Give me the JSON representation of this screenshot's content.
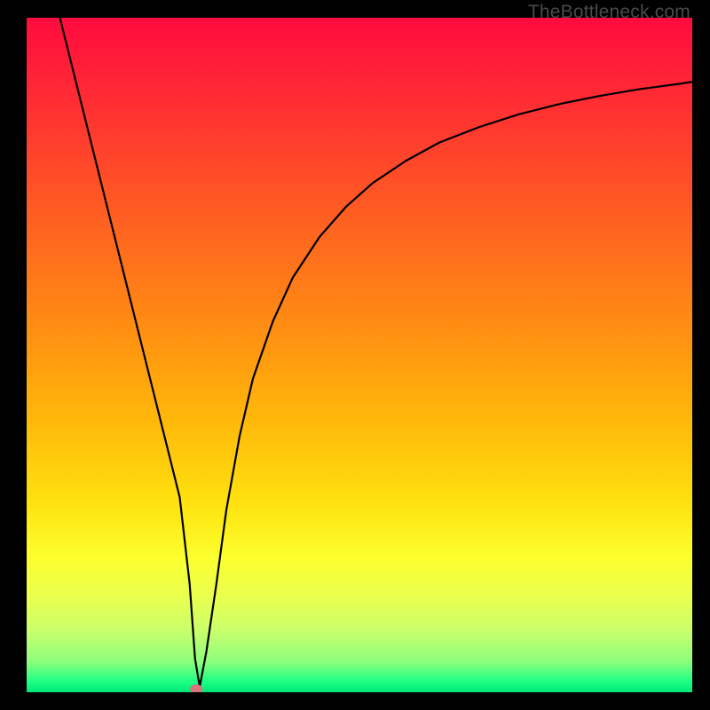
{
  "watermark": "TheBottleneck.com",
  "chart_data": {
    "type": "line",
    "title": "",
    "xlabel": "",
    "ylabel": "",
    "xlim": [
      0,
      100
    ],
    "ylim": [
      0,
      100
    ],
    "gradient_stops": [
      {
        "offset": 0.0,
        "color": "#ff0b3e"
      },
      {
        "offset": 0.12,
        "color": "#ff2c33"
      },
      {
        "offset": 0.28,
        "color": "#ff5a23"
      },
      {
        "offset": 0.45,
        "color": "#ff8b13"
      },
      {
        "offset": 0.6,
        "color": "#ffb90a"
      },
      {
        "offset": 0.72,
        "color": "#ffe20f"
      },
      {
        "offset": 0.8,
        "color": "#fcff2d"
      },
      {
        "offset": 0.86,
        "color": "#e9ff4f"
      },
      {
        "offset": 0.91,
        "color": "#c8ff6b"
      },
      {
        "offset": 0.955,
        "color": "#8dff7d"
      },
      {
        "offset": 0.985,
        "color": "#1bff84"
      },
      {
        "offset": 1.0,
        "color": "#00e57a"
      }
    ],
    "curve": {
      "x": [
        5,
        7,
        9,
        11,
        13,
        15,
        17,
        19,
        21,
        23,
        24.5,
        25.3,
        26,
        27,
        28.5,
        30,
        32,
        34,
        37,
        40,
        44,
        48,
        52,
        57,
        62,
        68,
        74,
        80,
        86,
        92,
        98,
        100
      ],
      "y": [
        100,
        92.1,
        84.2,
        76.3,
        68.4,
        60.5,
        52.6,
        44.7,
        36.8,
        28.9,
        16,
        5,
        0.8,
        6,
        16,
        27,
        38,
        46.5,
        55,
        61.5,
        67.5,
        72,
        75.5,
        78.8,
        81.5,
        83.8,
        85.7,
        87.2,
        88.4,
        89.4,
        90.2,
        90.5
      ]
    },
    "marker": {
      "x": 25.5,
      "y": 0.5,
      "color": "#d9737e"
    }
  }
}
